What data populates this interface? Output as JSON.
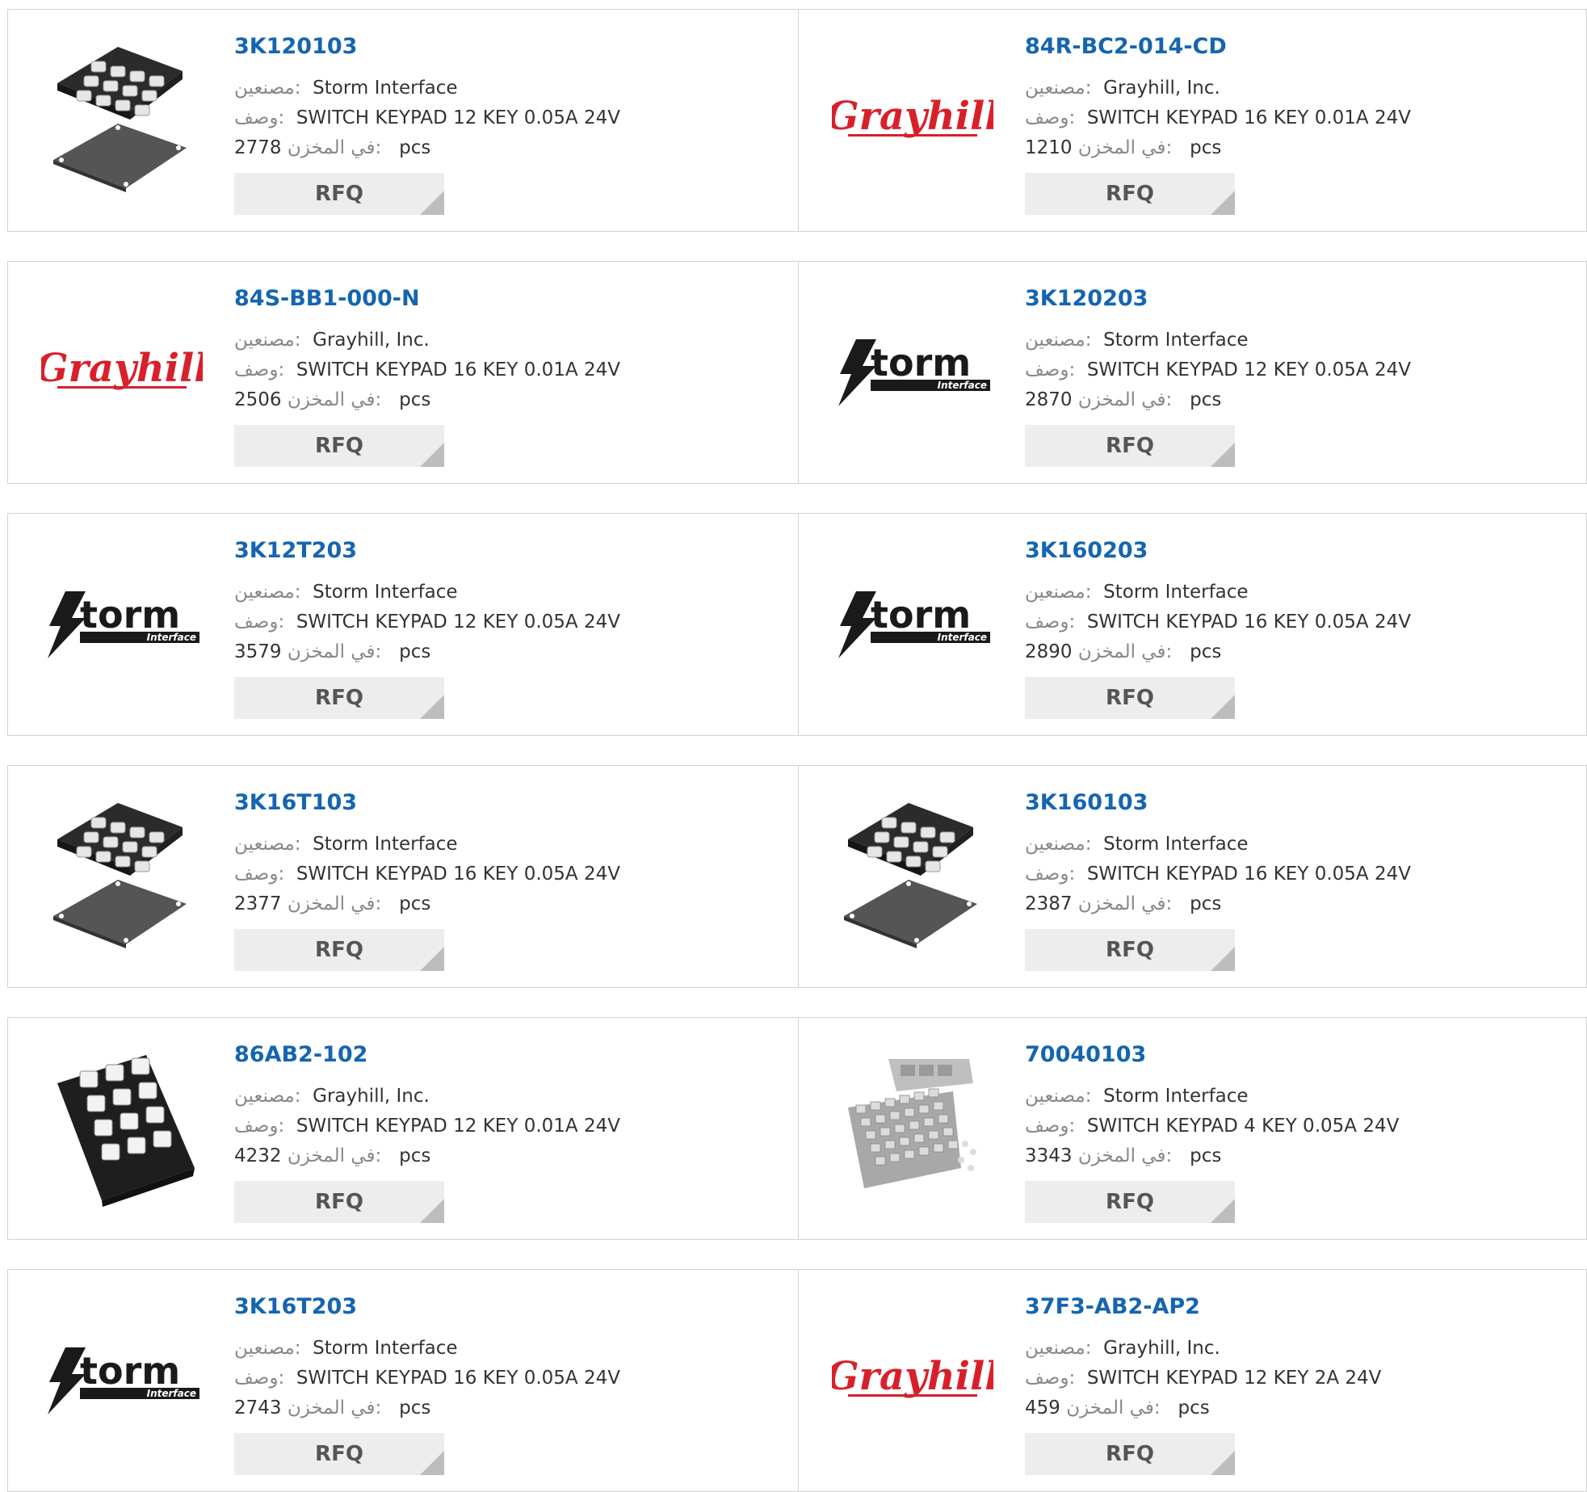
{
  "labels": {
    "manufacturer": "مصنعين:",
    "description": "وصف:",
    "stock": "في المخزن:",
    "unit": "pcs",
    "rfq": "RFQ"
  },
  "colors": {
    "part_link": "#1565b0",
    "grayhill_red": "#d8202a",
    "storm_black": "#1a1a1a",
    "border": "#d2d2d2",
    "button_bg": "#ededed"
  },
  "products": [
    {
      "part": "3K120103",
      "manufacturer": "Storm Interface",
      "description": "SWITCH KEYPAD 12 KEY 0.05A 24V",
      "stock": "2778",
      "image": "keypad-with-gasket"
    },
    {
      "part": "84R-BC2-014-CD",
      "manufacturer": "Grayhill, Inc.",
      "description": "SWITCH KEYPAD 16 KEY 0.01A 24V",
      "stock": "1210",
      "image": "grayhill-logo"
    },
    {
      "part": "84S-BB1-000-N",
      "manufacturer": "Grayhill, Inc.",
      "description": "SWITCH KEYPAD 16 KEY 0.01A 24V",
      "stock": "2506",
      "image": "grayhill-logo"
    },
    {
      "part": "3K120203",
      "manufacturer": "Storm Interface",
      "description": "SWITCH KEYPAD 12 KEY 0.05A 24V",
      "stock": "2870",
      "image": "storm-logo"
    },
    {
      "part": "3K12T203",
      "manufacturer": "Storm Interface",
      "description": "SWITCH KEYPAD 12 KEY 0.05A 24V",
      "stock": "3579",
      "image": "storm-logo"
    },
    {
      "part": "3K160203",
      "manufacturer": "Storm Interface",
      "description": "SWITCH KEYPAD 16 KEY 0.05A 24V",
      "stock": "2890",
      "image": "storm-logo"
    },
    {
      "part": "3K16T103",
      "manufacturer": "Storm Interface",
      "description": "SWITCH KEYPAD 16 KEY 0.05A 24V",
      "stock": "2377",
      "image": "keypad-with-gasket"
    },
    {
      "part": "3K160103",
      "manufacturer": "Storm Interface",
      "description": "SWITCH KEYPAD 16 KEY 0.05A 24V",
      "stock": "2387",
      "image": "keypad-with-gasket"
    },
    {
      "part": "86AB2-102",
      "manufacturer": "Grayhill, Inc.",
      "description": "SWITCH KEYPAD 12 KEY 0.01A 24V",
      "stock": "4232",
      "image": "black-phone-keypad"
    },
    {
      "part": "70040103",
      "manufacturer": "Storm Interface",
      "description": "SWITCH KEYPAD 4 KEY 0.05A 24V",
      "stock": "3343",
      "image": "membrane-keypad-kit"
    },
    {
      "part": "3K16T203",
      "manufacturer": "Storm Interface",
      "description": "SWITCH KEYPAD 16 KEY 0.05A 24V",
      "stock": "2743",
      "image": "storm-logo"
    },
    {
      "part": "37F3-AB2-AP2",
      "manufacturer": "Grayhill, Inc.",
      "description": "SWITCH KEYPAD 12 KEY 2A 24V",
      "stock": "459",
      "image": "grayhill-logo"
    }
  ]
}
